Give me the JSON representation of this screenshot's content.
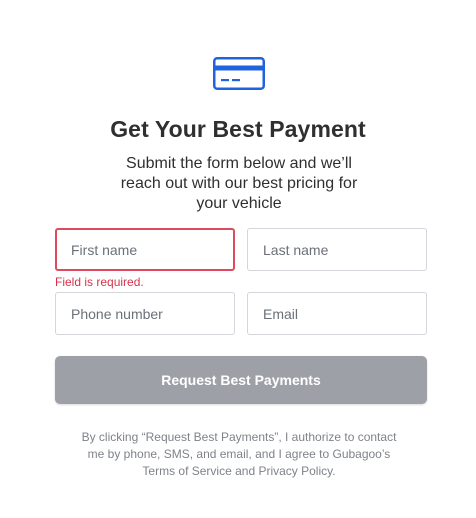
{
  "header": {
    "icon": "credit-card-icon",
    "accent_color": "#1f63e0",
    "title": "Get Your Best Payment",
    "subtitle": "Submit the form below and we’ll reach out with our best pricing for your vehicle"
  },
  "form": {
    "first_name": {
      "placeholder": "First name",
      "value": "",
      "error": "Field is required."
    },
    "last_name": {
      "placeholder": "Last name",
      "value": ""
    },
    "phone": {
      "placeholder": "Phone number",
      "value": ""
    },
    "email": {
      "placeholder": "Email",
      "value": ""
    },
    "submit_label": "Request Best Payments",
    "error_color": "#e04a5f"
  },
  "disclaimer": "By clicking “Request Best Payments”, I authorize to contact me by phone, SMS, and email, and I agree to Gubagoo’s Terms of Service and Privacy Policy."
}
